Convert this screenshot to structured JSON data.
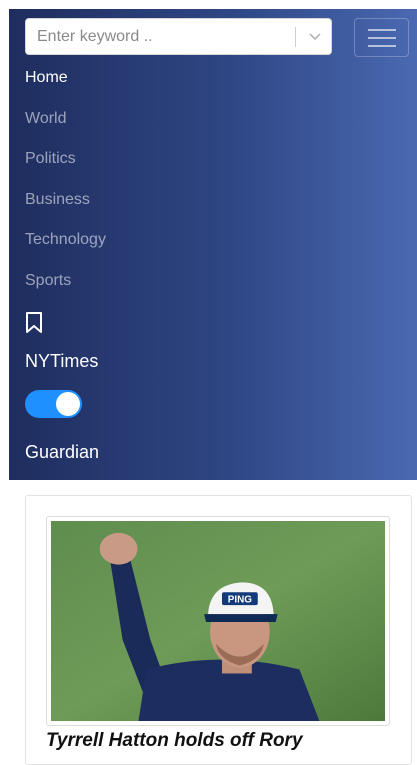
{
  "search": {
    "placeholder": "Enter keyword .."
  },
  "nav": {
    "items": [
      {
        "label": "Home",
        "active": true
      },
      {
        "label": "World",
        "active": false
      },
      {
        "label": "Politics",
        "active": false
      },
      {
        "label": "Business",
        "active": false
      },
      {
        "label": "Technology",
        "active": false
      },
      {
        "label": "Sports",
        "active": false
      }
    ],
    "bookmark_icon": "bookmark-icon",
    "source_a": "NYTimes",
    "source_toggle_on": true,
    "source_b": "Guardian"
  },
  "article": {
    "headline": "Tyrrell Hatton holds off Rory",
    "cap_brand": "PING"
  },
  "colors": {
    "nav_gradient_start": "#1f2d5e",
    "nav_gradient_end": "#4a69b1",
    "toggle_on": "#1e90ff"
  }
}
